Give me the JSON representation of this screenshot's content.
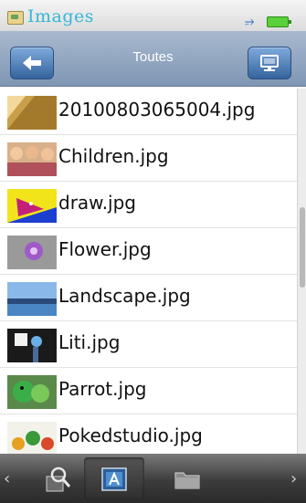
{
  "status_bar": {
    "app_title": "Images",
    "usb_icon": "usb-icon",
    "battery_icon": "battery-icon"
  },
  "navbar": {
    "title": "Toutes",
    "back_icon": "back-arrow-icon",
    "view_icon": "monitor-icon"
  },
  "files": [
    {
      "name": "20100803065004.jpg",
      "thumb": "thumb-1"
    },
    {
      "name": "Children.jpg",
      "thumb": "thumb-2"
    },
    {
      "name": "draw.jpg",
      "thumb": "thumb-3"
    },
    {
      "name": "Flower.jpg",
      "thumb": "thumb-4"
    },
    {
      "name": "Landscape.jpg",
      "thumb": "thumb-5"
    },
    {
      "name": "Liti.jpg",
      "thumb": "thumb-6"
    },
    {
      "name": "Parrot.jpg",
      "thumb": "thumb-7"
    },
    {
      "name": "Pokedstudio.jpg",
      "thumb": "thumb-8"
    }
  ],
  "toolbar": {
    "icons": [
      "search-icon",
      "alphabet-sort-icon",
      "folder-icon"
    ],
    "selected": "alphabet-sort-icon"
  },
  "colors": {
    "title": "#35b7d8",
    "nav_button": "#35649e",
    "battery": "#5ad03a"
  }
}
